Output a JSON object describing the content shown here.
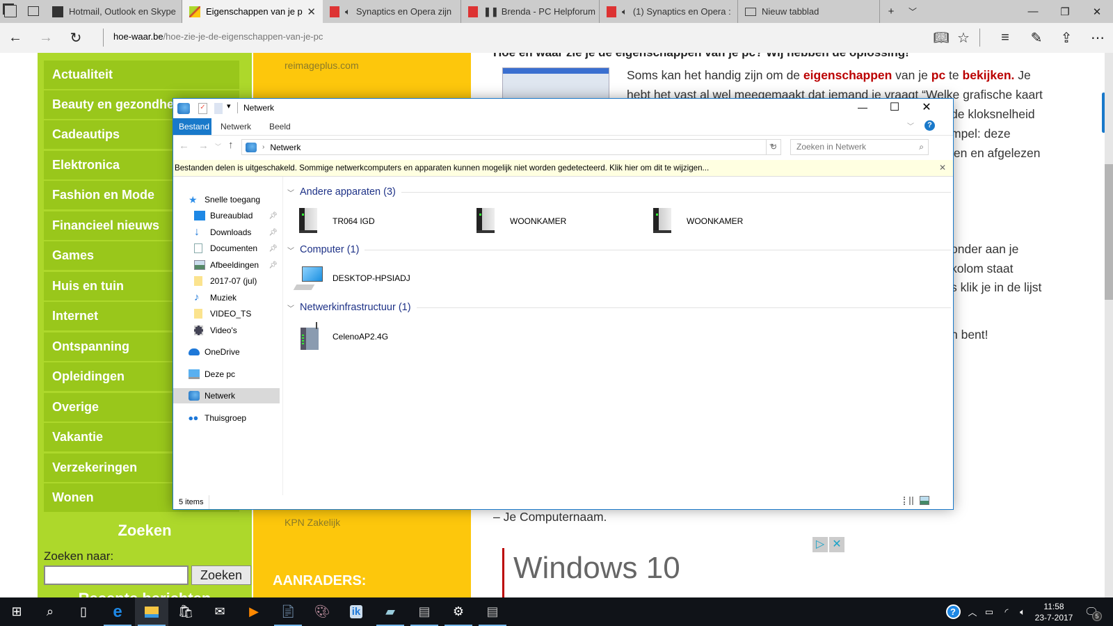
{
  "browser": {
    "tabs": [
      {
        "label": "Hotmail, Outlook en Skype",
        "icon": "outlook-icon",
        "active": false
      },
      {
        "label": "Eigenschappen van je p",
        "icon": "site-favicon",
        "active": true
      },
      {
        "label": "Synaptics en Opera zijn",
        "icon": "forum-icon",
        "audio": true,
        "active": false
      },
      {
        "label": "Brenda - PC Helpforum",
        "icon": "forum-icon",
        "paused": true,
        "active": false
      },
      {
        "label": "(1) Synaptics en Opera :",
        "icon": "forum-icon",
        "audio": true,
        "active": false
      },
      {
        "label": "Nieuw tabblad",
        "icon": "new-tab-icon",
        "active": false
      }
    ],
    "url_host": "hoe-waar.be",
    "url_path": "/hoe-zie-je-de-eigenschappen-van-je-pc"
  },
  "site": {
    "menu": [
      "Actualiteit",
      "Beauty en gezondheid",
      "Cadeautips",
      "Elektronica",
      "Fashion en Mode",
      "Financieel nieuws",
      "Games",
      "Huis en tuin",
      "Internet",
      "Ontspanning",
      "Opleidingen",
      "Overige",
      "Vakantie",
      "Verzekeringen",
      "Wonen"
    ],
    "search": {
      "heading": "Zoeken",
      "label": "Zoeken naar:",
      "value": "",
      "button": "Zoeken"
    },
    "recent_heading": "Recente berichten",
    "yellow": {
      "ad_link_top": "reimageplus.com",
      "ad_link_bottom": "KPN Zakelijk",
      "heading": "AANRADERS:"
    },
    "article": {
      "title": "Hoe en waar zie je de eigenschappen van je pc? Wij hebben de oplossing!",
      "line1_a": "Soms kan het handig zijn om de ",
      "line1_b": "eigenschappen",
      "line1_c": " van je ",
      "line1_d": "pc",
      "line1_e": " te ",
      "line1_f": "bekijken.",
      "line1_g": " Je",
      "line2": "hebt het vast al wel meegemaakt dat iemand je vraagt “Welke grafische kaart",
      "fragments": [
        "de kloksnelheid",
        "mpel: deze",
        "len en afgelezen",
        "onder aan je",
        "kolom staat",
        "s klik je in de lijst",
        "n bent!"
      ],
      "computername": "– Je Computernaam.",
      "ad_text": "Windows 10"
    }
  },
  "explorer": {
    "title": "Netwerk",
    "ribbon_tabs": [
      "Bestand",
      "Netwerk",
      "Beeld"
    ],
    "address": "Netwerk",
    "search_placeholder": "Zoeken in Netwerk",
    "infobar": "Bestanden delen is uitgeschakeld. Sommige netwerkcomputers en apparaten kunnen mogelijk niet worden gedetecteerd. Klik hier om dit te wijzigen...",
    "nav": [
      {
        "label": "Snelle toegang",
        "icon": "star-icon",
        "level": 0
      },
      {
        "label": "Bureaublad",
        "icon": "desktop-icon",
        "level": 1,
        "pinned": true
      },
      {
        "label": "Downloads",
        "icon": "download-icon",
        "level": 1,
        "pinned": true
      },
      {
        "label": "Documenten",
        "icon": "document-icon",
        "level": 1,
        "pinned": true
      },
      {
        "label": "Afbeeldingen",
        "icon": "pictures-icon",
        "level": 1,
        "pinned": true
      },
      {
        "label": "2017-07 (jul)",
        "icon": "folder-icon",
        "level": 1
      },
      {
        "label": "Muziek",
        "icon": "music-icon",
        "level": 1
      },
      {
        "label": "VIDEO_TS",
        "icon": "folder-icon",
        "level": 1
      },
      {
        "label": "Video's",
        "icon": "video-icon",
        "level": 1
      },
      {
        "label": "OneDrive",
        "icon": "onedrive-icon",
        "level": 0
      },
      {
        "label": "Deze pc",
        "icon": "pc-icon",
        "level": 0
      },
      {
        "label": "Netwerk",
        "icon": "network-icon",
        "level": 0,
        "selected": true
      },
      {
        "label": "Thuisgroep",
        "icon": "homegroup-icon",
        "level": 0
      }
    ],
    "groups": [
      {
        "header": "Andere apparaten (3)",
        "items": [
          {
            "name": "TR064 IGD",
            "icon": "device-icon"
          },
          {
            "name": "WOONKAMER",
            "icon": "device-icon"
          },
          {
            "name": "WOONKAMER",
            "icon": "device-icon"
          }
        ]
      },
      {
        "header": "Computer (1)",
        "items": [
          {
            "name": "DESKTOP-HPSIADJ",
            "icon": "computer-icon"
          }
        ]
      },
      {
        "header": "Netwerkinfrastructuur (1)",
        "items": [
          {
            "name": "CelenoAP2.4G",
            "icon": "router-icon"
          }
        ]
      }
    ],
    "status": "5 items"
  },
  "taskbar": {
    "time": "11:58",
    "date": "23-7-2017",
    "notifications": "5"
  },
  "colors": {
    "green": "#add82b",
    "menu_green": "#99c71b",
    "yellow": "#fdc70c",
    "accent": "#1979ca",
    "highlight_red": "#bb0000"
  }
}
